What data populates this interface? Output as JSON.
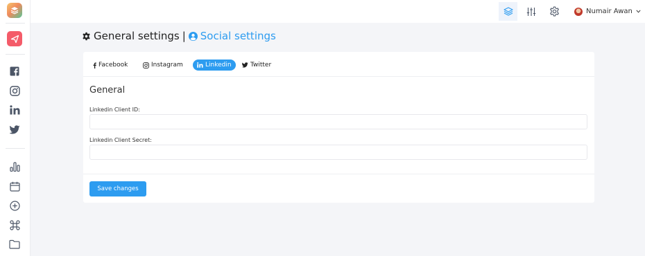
{
  "topbar": {
    "user_name": "Numair Awan",
    "icons": [
      "layers-icon",
      "sliders-icon",
      "gear-icon"
    ]
  },
  "sidebar": {
    "items": [
      {
        "icon": "facebook-icon"
      },
      {
        "icon": "instagram-icon"
      },
      {
        "icon": "linkedin-icon"
      },
      {
        "icon": "twitter-icon"
      },
      {
        "icon": "bar-chart-icon"
      },
      {
        "icon": "calendar-icon"
      },
      {
        "icon": "plus-circle-icon"
      },
      {
        "icon": "command-icon"
      },
      {
        "icon": "folder-icon"
      }
    ]
  },
  "header": {
    "general_settings": "General settings",
    "separator": "|",
    "social_settings": "Social settings"
  },
  "tabs": [
    {
      "label": "Facebook",
      "icon": "facebook-icon"
    },
    {
      "label": "Instagram",
      "icon": "instagram-icon"
    },
    {
      "label": "Linkedin",
      "icon": "linkedin-icon",
      "active": true
    },
    {
      "label": "Twitter",
      "icon": "twitter-icon"
    }
  ],
  "form": {
    "section_title": "General",
    "client_id_label": "Linkedin Client ID:",
    "client_id_value": "",
    "client_secret_label": "Linkedin Client Secret:",
    "client_secret_value": "",
    "save_label": "Save changes"
  },
  "colors": {
    "accent": "#2d9cf0",
    "send_button": "#f45b69",
    "background": "#f4f5f8"
  }
}
